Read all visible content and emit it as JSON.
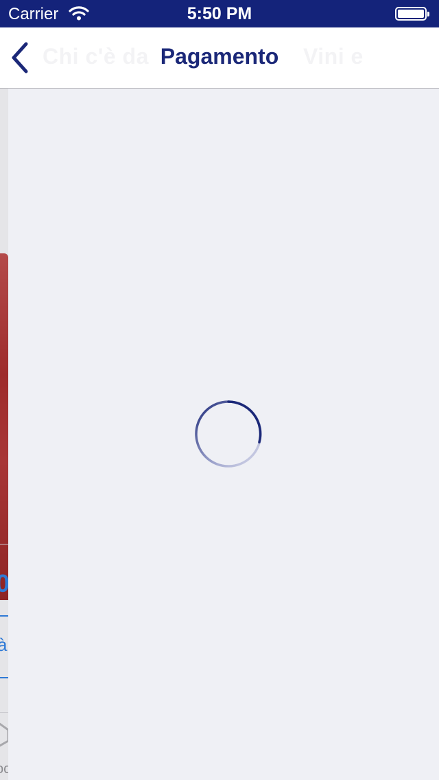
{
  "status_bar": {
    "carrier": "Carrier",
    "time": "5:50 PM"
  },
  "nav": {
    "title": "Pagamento",
    "ghost_title_left": "Chi c'è da",
    "ghost_title_right": "Vini e"
  },
  "underlay": {
    "fragment_big": "0",
    "fragment_a": "à",
    "fragment_small": "oc"
  },
  "colors": {
    "status_bar": "#14237A",
    "nav_tint": "#1B2878",
    "background": "#EFF0F5",
    "link": "#2F7AD6"
  },
  "content": {
    "state": "loading",
    "spinner_icon": "activity-indicator-icon"
  }
}
